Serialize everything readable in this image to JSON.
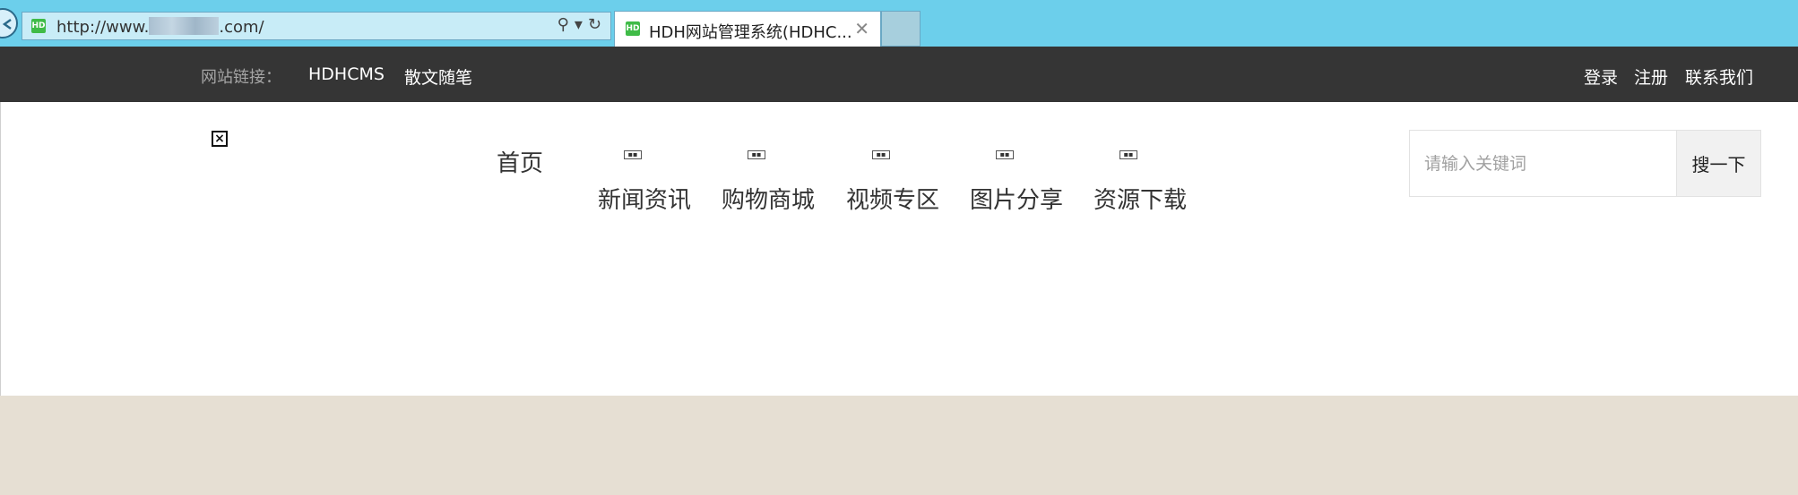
{
  "browser": {
    "url_prefix": "http://www.",
    "url_suffix": ".com/",
    "tab_title": "HDH网站管理系统(HDHC...",
    "tab_close": "✕",
    "favicon_text": "HD"
  },
  "topbar": {
    "site_links_label": "网站链接：",
    "links": [
      "HDHCMS",
      "散文随笔"
    ],
    "right_links": [
      "登录",
      "注册",
      "联系我们"
    ]
  },
  "nav": {
    "home": "首页",
    "items": [
      "新闻资讯",
      "购物商城",
      "视频专区",
      "图片分享",
      "资源下载"
    ]
  },
  "search": {
    "placeholder": "请输入关键词",
    "button": "搜一下"
  },
  "colors": {
    "browser_bar": "#6ccfeb",
    "topbar": "#353535",
    "footer_band": "#e6dfd3"
  }
}
